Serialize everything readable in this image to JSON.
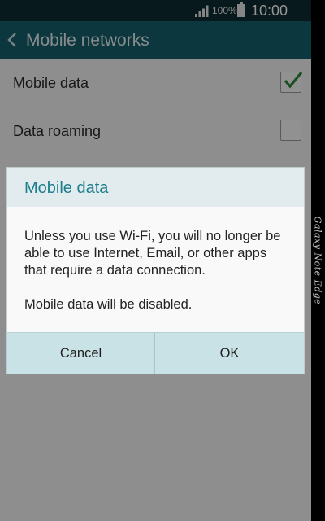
{
  "status_bar": {
    "battery_percent": "100%",
    "time": "10:00",
    "icons": [
      "signal-icon",
      "battery-icon"
    ]
  },
  "action_bar": {
    "title": "Mobile networks",
    "back_icon": "back-chevron-icon"
  },
  "settings": {
    "items": [
      {
        "label": "Mobile data",
        "checked": true
      },
      {
        "label": "Data roaming",
        "checked": false
      }
    ]
  },
  "dialog": {
    "title": "Mobile data",
    "message": "Unless you use Wi-Fi, you will no longer be able to use Internet, Email, or other apps that require a data connection.",
    "message2": "Mobile data will be disabled.",
    "cancel_label": "Cancel",
    "ok_label": "OK"
  },
  "device": {
    "edge_label": "Galaxy Note Edge"
  },
  "colors": {
    "status_bar": "#0f2b33",
    "action_bar": "#175f6b",
    "dialog_title": "#1b7d8c",
    "checkmark": "#2e8b3a",
    "dialog_buttons": "#c9e2e6"
  }
}
